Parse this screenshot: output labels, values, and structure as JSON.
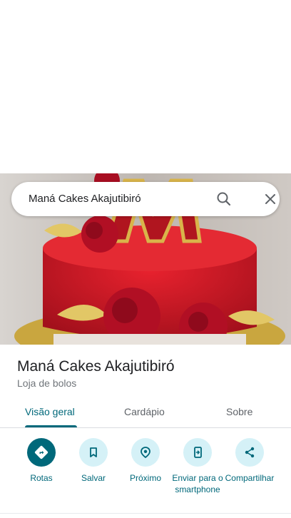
{
  "search": {
    "query": "Maná Cakes Akajutibiró"
  },
  "place": {
    "name": "Maná Cakes Akajutibiró",
    "category": "Loja de bolos"
  },
  "tabs": [
    {
      "label": "Visão geral",
      "active": true
    },
    {
      "label": "Cardápio",
      "active": false
    },
    {
      "label": "Sobre",
      "active": false
    }
  ],
  "actions": [
    {
      "label": "Rotas",
      "icon": "directions-icon"
    },
    {
      "label": "Salvar",
      "icon": "bookmark-icon"
    },
    {
      "label": "Próximo",
      "icon": "nearby-icon"
    },
    {
      "label": "Enviar para o smartphone",
      "icon": "send-to-phone-icon"
    },
    {
      "label": "Compartilhar",
      "icon": "share-icon"
    }
  ],
  "colors": {
    "accent": "#00687a",
    "action_bg": "#d5f1f7",
    "title": "#202124",
    "secondary_text": "#70757a"
  }
}
